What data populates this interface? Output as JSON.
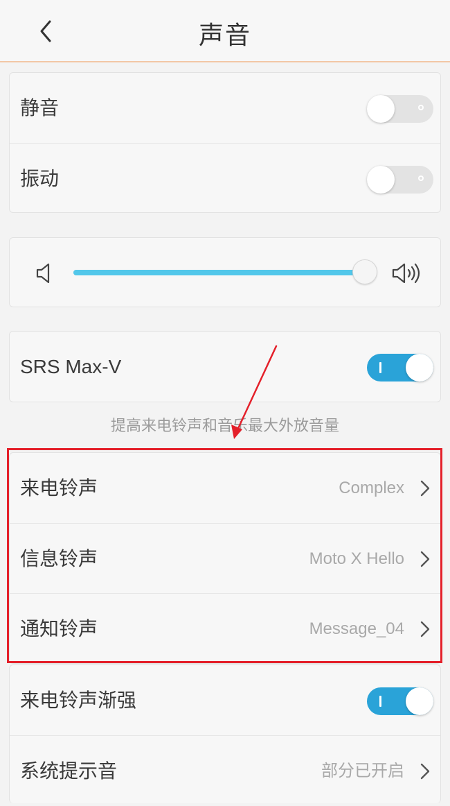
{
  "header": {
    "title": "声音"
  },
  "group1": [
    {
      "label": "静音",
      "toggle": "off"
    },
    {
      "label": "振动",
      "toggle": "off"
    }
  ],
  "volume": {
    "level": 0.98
  },
  "srs": {
    "label": "SRS Max-V",
    "toggle": "on",
    "description": "提高来电铃声和音乐最大外放音量"
  },
  "ringtones": [
    {
      "label": "来电铃声",
      "value": "Complex"
    },
    {
      "label": "信息铃声",
      "value": "Moto X Hello"
    },
    {
      "label": "通知铃声",
      "value": "Message_04"
    }
  ],
  "group4": {
    "crescendo": {
      "label": "来电铃声渐强",
      "toggle": "on"
    },
    "system_sounds": {
      "label": "系统提示音",
      "value": "部分已开启"
    }
  },
  "colors": {
    "accent": "#2aa3d8",
    "slider_fill": "#52c7ea",
    "annotation": "#e4202a"
  }
}
